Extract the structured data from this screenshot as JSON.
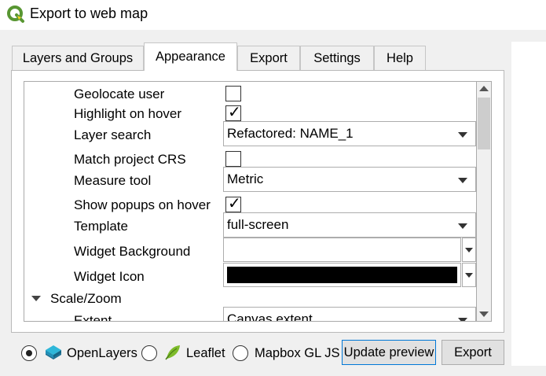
{
  "window": {
    "title": "Export to web map"
  },
  "tabs": [
    {
      "label": "Layers and Groups",
      "active": false
    },
    {
      "label": "Appearance",
      "active": true
    },
    {
      "label": "Export",
      "active": false
    },
    {
      "label": "Settings",
      "active": false
    },
    {
      "label": "Help",
      "active": false
    }
  ],
  "appearance": {
    "geolocate_user": {
      "label": "Geolocate user",
      "checked": false
    },
    "highlight_on_hover": {
      "label": "Highlight on hover",
      "checked": true
    },
    "layer_search": {
      "label": "Layer search",
      "value": "Refactored: NAME_1"
    },
    "match_project_crs": {
      "label": "Match project CRS",
      "checked": false
    },
    "measure_tool": {
      "label": "Measure tool",
      "value": "Metric"
    },
    "show_popups_on_hover": {
      "label": "Show popups on hover",
      "checked": true
    },
    "template": {
      "label": "Template",
      "value": "full-screen"
    },
    "widget_background": {
      "label": "Widget Background",
      "value": ""
    },
    "widget_icon": {
      "label": "Widget Icon",
      "color": "#000000"
    },
    "scale_zoom_section": {
      "label": "Scale/Zoom",
      "expanded": true
    },
    "extent": {
      "label": "Extent",
      "value": "Canvas extent"
    }
  },
  "checkmark_glyph": "✓",
  "footer": {
    "frameworks": [
      {
        "label": "OpenLayers",
        "selected": true,
        "icon": "openlayers-icon"
      },
      {
        "label": "Leaflet",
        "selected": false,
        "icon": "leaflet-icon"
      },
      {
        "label": "Mapbox GL JS",
        "selected": false,
        "icon": ""
      }
    ],
    "update_preview_label": "Update preview",
    "export_label": "Export"
  },
  "colors": {
    "accent": "#0078d7",
    "qgis_green": "#589632",
    "qgis_yellow": "#ee7913"
  }
}
